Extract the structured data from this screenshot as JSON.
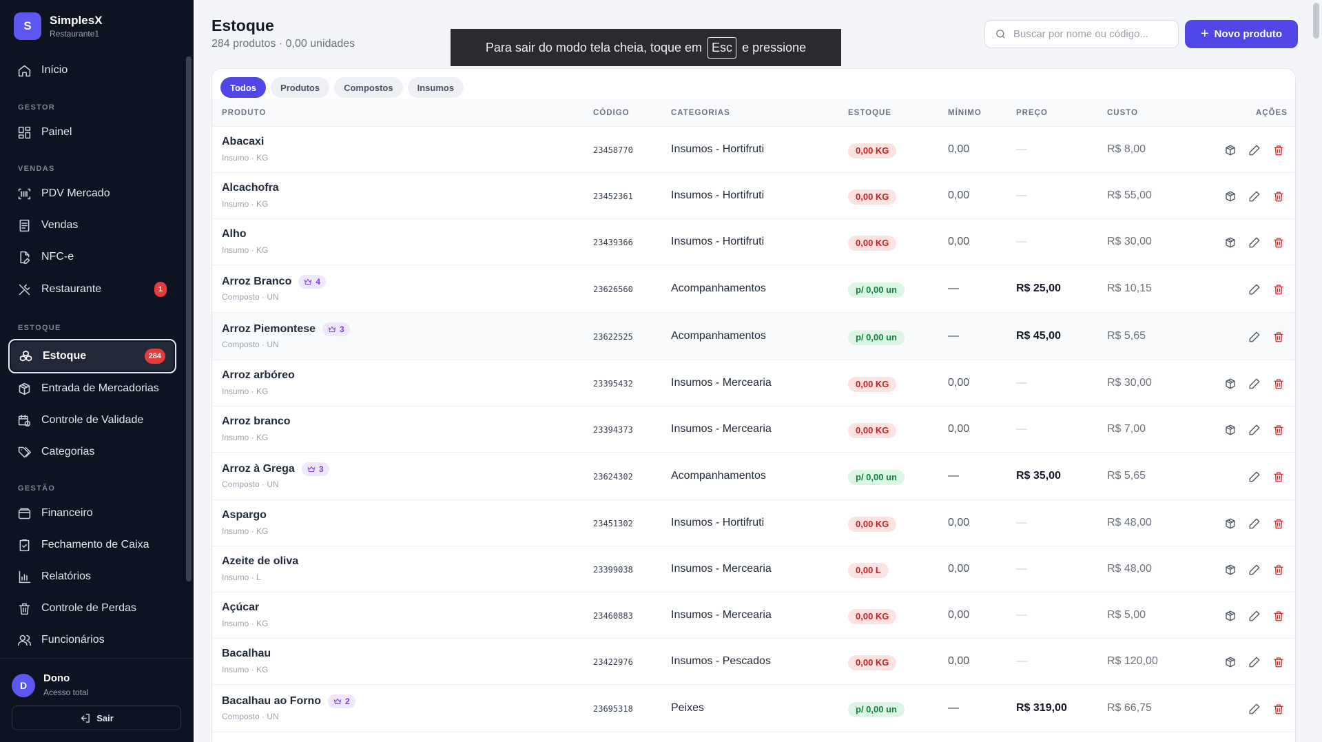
{
  "brand": {
    "initial": "S",
    "name": "SimplesX",
    "subtitle": "Restaurante1"
  },
  "sidebar": {
    "sections": {
      "gestor": "GESTOR",
      "vendas": "VENDAS",
      "estoque": "ESTOQUE",
      "gestao": "GESTÃO"
    },
    "items": {
      "inicio": "Início",
      "painel": "Painel",
      "pdv": "PDV Mercado",
      "vendas": "Vendas",
      "nfce": "NFC-e",
      "restaurante": "Restaurante",
      "restaurante_badge": "1",
      "estoque": "Estoque",
      "estoque_badge": "284",
      "entrada": "Entrada de Mercadorias",
      "validade": "Controle de Validade",
      "categorias": "Categorias",
      "financeiro": "Financeiro",
      "fechamento": "Fechamento de Caixa",
      "relatorios": "Relatórios",
      "perdas": "Controle de Perdas",
      "funcionarios": "Funcionários"
    },
    "user": {
      "initial": "D",
      "name": "Dono",
      "role": "Acesso total",
      "logout": "Sair"
    }
  },
  "header": {
    "title": "Estoque",
    "subtitle": "284 produtos · 0,00 unidades",
    "search_placeholder": "Buscar por nome ou código...",
    "new_button": "Novo produto"
  },
  "fullscreen_toast": {
    "before": "Para sair do modo tela cheia, toque em",
    "key": "Esc",
    "after": "e pressione"
  },
  "tabs": [
    "Todos",
    "Produtos",
    "Compostos",
    "Insumos"
  ],
  "table": {
    "headers": {
      "produto": "PRODUTO",
      "codigo": "CÓDIGO",
      "categorias": "CATEGORIAS",
      "estoque": "ESTOQUE",
      "minimo": "MÍNIMO",
      "preco": "PREÇO",
      "custo": "CUSTO",
      "acoes": "AÇÕES"
    },
    "rows": [
      {
        "name": "Abacaxi",
        "sub": "Insumo · KG",
        "tag": "",
        "code": "23458770",
        "category": "Insumos - Hortifruti",
        "stock": "0,00 KG",
        "stock_status": "red",
        "min": "0,00",
        "price": "—",
        "cost": "R$ 8,00",
        "stock_action": true
      },
      {
        "name": "Alcachofra",
        "sub": "Insumo · KG",
        "tag": "",
        "code": "23452361",
        "category": "Insumos - Hortifruti",
        "stock": "0,00 KG",
        "stock_status": "red",
        "min": "0,00",
        "price": "—",
        "cost": "R$ 55,00",
        "stock_action": true
      },
      {
        "name": "Alho",
        "sub": "Insumo · KG",
        "tag": "",
        "code": "23439366",
        "category": "Insumos - Hortifruti",
        "stock": "0,00 KG",
        "stock_status": "red",
        "min": "0,00",
        "price": "—",
        "cost": "R$ 30,00",
        "stock_action": true
      },
      {
        "name": "Arroz Branco",
        "sub": "Composto · UN",
        "tag": "4",
        "code": "23626560",
        "category": "Acompanhamentos",
        "stock": "p/ 0,00 un",
        "stock_status": "green",
        "min": "—",
        "price": "R$ 25,00",
        "cost": "R$ 10,15",
        "stock_action": false
      },
      {
        "name": "Arroz Piemontese",
        "sub": "Composto · UN",
        "tag": "3",
        "code": "23622525",
        "category": "Acompanhamentos",
        "stock": "p/ 0,00 un",
        "stock_status": "green",
        "min": "—",
        "price": "R$ 45,00",
        "cost": "R$ 5,65",
        "stock_action": false
      },
      {
        "name": "Arroz arbóreo",
        "sub": "Insumo · KG",
        "tag": "",
        "code": "23395432",
        "category": "Insumos - Mercearia",
        "stock": "0,00 KG",
        "stock_status": "red",
        "min": "0,00",
        "price": "—",
        "cost": "R$ 30,00",
        "stock_action": true
      },
      {
        "name": "Arroz branco",
        "sub": "Insumo · KG",
        "tag": "",
        "code": "23394373",
        "category": "Insumos - Mercearia",
        "stock": "0,00 KG",
        "stock_status": "red",
        "min": "0,00",
        "price": "—",
        "cost": "R$ 7,00",
        "stock_action": true
      },
      {
        "name": "Arroz à Grega",
        "sub": "Composto · UN",
        "tag": "3",
        "code": "23624302",
        "category": "Acompanhamentos",
        "stock": "p/ 0,00 un",
        "stock_status": "green",
        "min": "—",
        "price": "R$ 35,00",
        "cost": "R$ 5,65",
        "stock_action": false
      },
      {
        "name": "Aspargo",
        "sub": "Insumo · KG",
        "tag": "",
        "code": "23451302",
        "category": "Insumos - Hortifruti",
        "stock": "0,00 KG",
        "stock_status": "red",
        "min": "0,00",
        "price": "—",
        "cost": "R$ 48,00",
        "stock_action": true
      },
      {
        "name": "Azeite de oliva",
        "sub": "Insumo · L",
        "tag": "",
        "code": "23399038",
        "category": "Insumos - Mercearia",
        "stock": "0,00 L",
        "stock_status": "red",
        "min": "0,00",
        "price": "—",
        "cost": "R$ 48,00",
        "stock_action": true
      },
      {
        "name": "Açúcar",
        "sub": "Insumo · KG",
        "tag": "",
        "code": "23460883",
        "category": "Insumos - Mercearia",
        "stock": "0,00 KG",
        "stock_status": "red",
        "min": "0,00",
        "price": "—",
        "cost": "R$ 5,00",
        "stock_action": true
      },
      {
        "name": "Bacalhau",
        "sub": "Insumo · KG",
        "tag": "",
        "code": "23422976",
        "category": "Insumos - Pescados",
        "stock": "0,00 KG",
        "stock_status": "red",
        "min": "0,00",
        "price": "—",
        "cost": "R$ 120,00",
        "stock_action": true
      },
      {
        "name": "Bacalhau ao Forno",
        "sub": "Composto · UN",
        "tag": "2",
        "code": "23695318",
        "category": "Peixes",
        "stock": "p/ 0,00 un",
        "stock_status": "green",
        "min": "—",
        "price": "R$ 319,00",
        "cost": "R$ 66,75",
        "stock_action": false
      }
    ]
  },
  "colors": {
    "accent": "#4f46e5",
    "sidebar_bg": "#0e1322",
    "danger": "#e02424",
    "success": "#15803d"
  }
}
